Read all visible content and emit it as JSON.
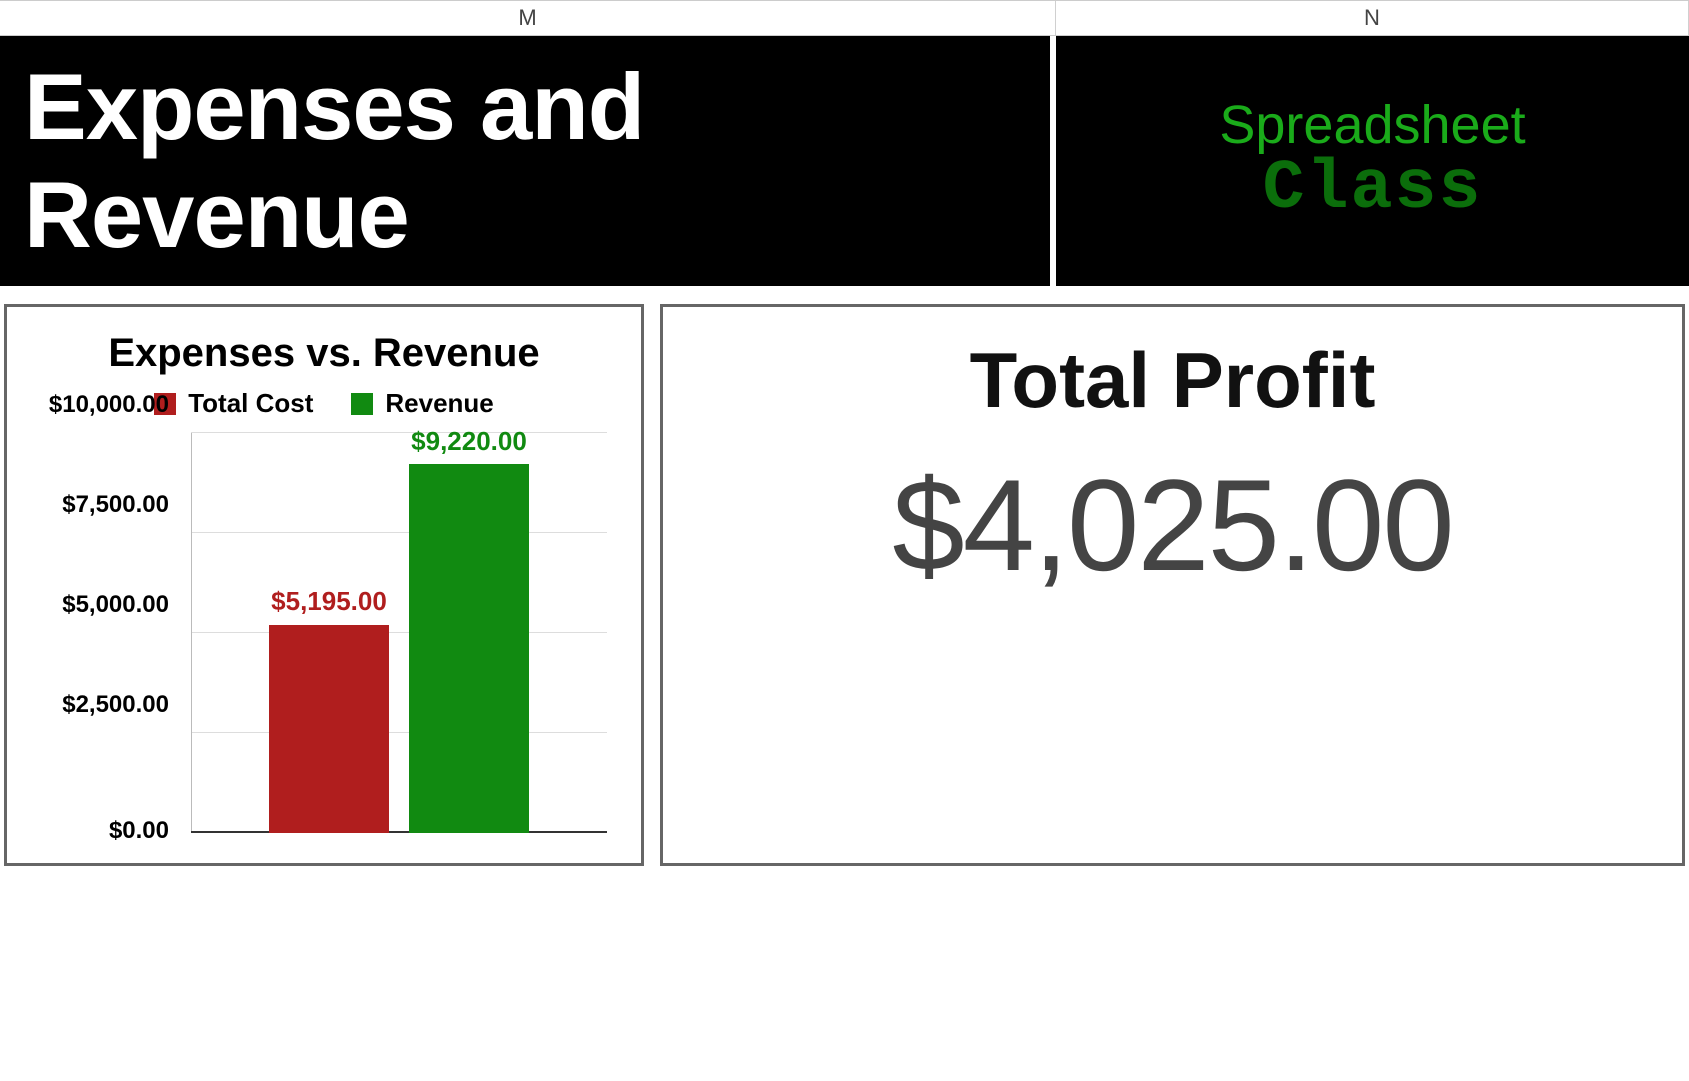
{
  "columns": {
    "m": "M",
    "n": "N"
  },
  "header": {
    "title": "Expenses and Revenue",
    "logo_line1": "Spreadsheet",
    "logo_line2": "Class"
  },
  "chart_data": {
    "type": "bar",
    "title": "Expenses vs. Revenue",
    "series": [
      {
        "name": "Total Cost",
        "color": "#b01e1e",
        "value": 5195.0,
        "value_label": "$5,195.00"
      },
      {
        "name": "Revenue",
        "color": "#118a11",
        "value": 9220.0,
        "value_label": "$9,220.00"
      }
    ],
    "ylim": [
      0,
      10000
    ],
    "yticks": [
      0,
      2500,
      5000,
      7500,
      10000
    ],
    "ytick_labels": [
      "$0.00",
      "$2,500.00",
      "$5,000.00",
      "$7,500.00",
      "$10,000.00"
    ],
    "xlabel": "",
    "ylabel": ""
  },
  "profit": {
    "title": "Total Profit",
    "value": "$4,025.00"
  }
}
